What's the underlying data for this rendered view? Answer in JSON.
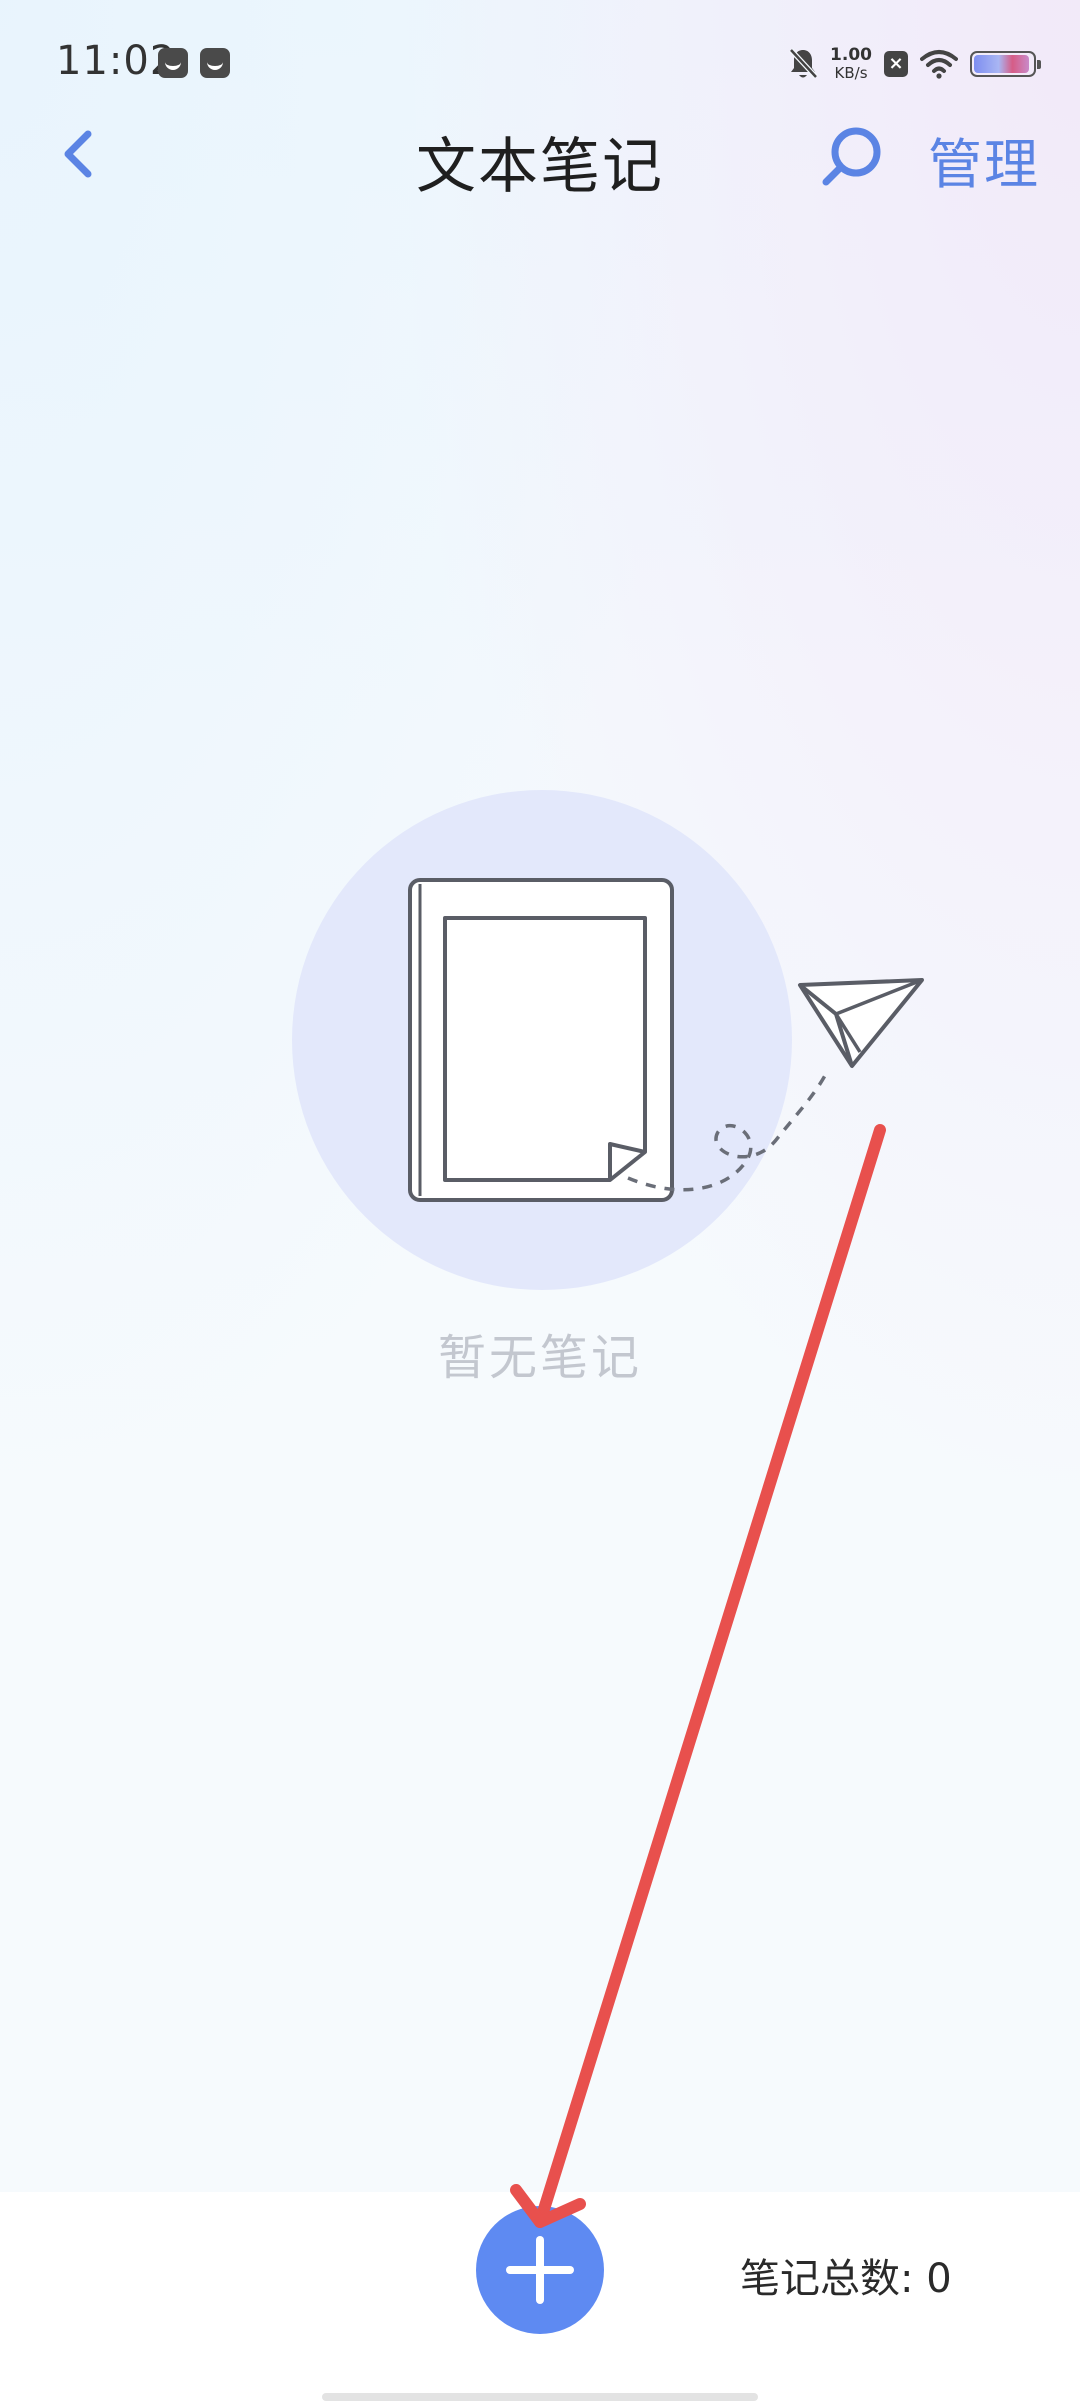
{
  "status_bar": {
    "time": "11:02",
    "net_speed_value": "1.00",
    "net_speed_unit": "KB/s",
    "sim_mark": "×",
    "battery_level": 0.95,
    "icons": [
      "app-notification-icon",
      "app-notification-icon-2",
      "mute-bell-icon",
      "sim-disabled-icon",
      "wifi-icon",
      "battery-icon"
    ]
  },
  "header": {
    "title": "文本笔记",
    "manage_label": "管理",
    "back_icon": "chevron-left-icon",
    "search_icon": "search-icon"
  },
  "empty_state": {
    "message": "暂无笔记",
    "illustration": "notebook-with-paper-plane"
  },
  "footer": {
    "count_label": "笔记总数:",
    "count_value": "0",
    "add_icon": "plus-icon"
  },
  "colors": {
    "accent": "#5b84e4",
    "add_button": "#5e8af2",
    "empty_text": "#c3c7cf",
    "annotation": "#e8504d",
    "illustration_circle": "#e3e8fb"
  }
}
